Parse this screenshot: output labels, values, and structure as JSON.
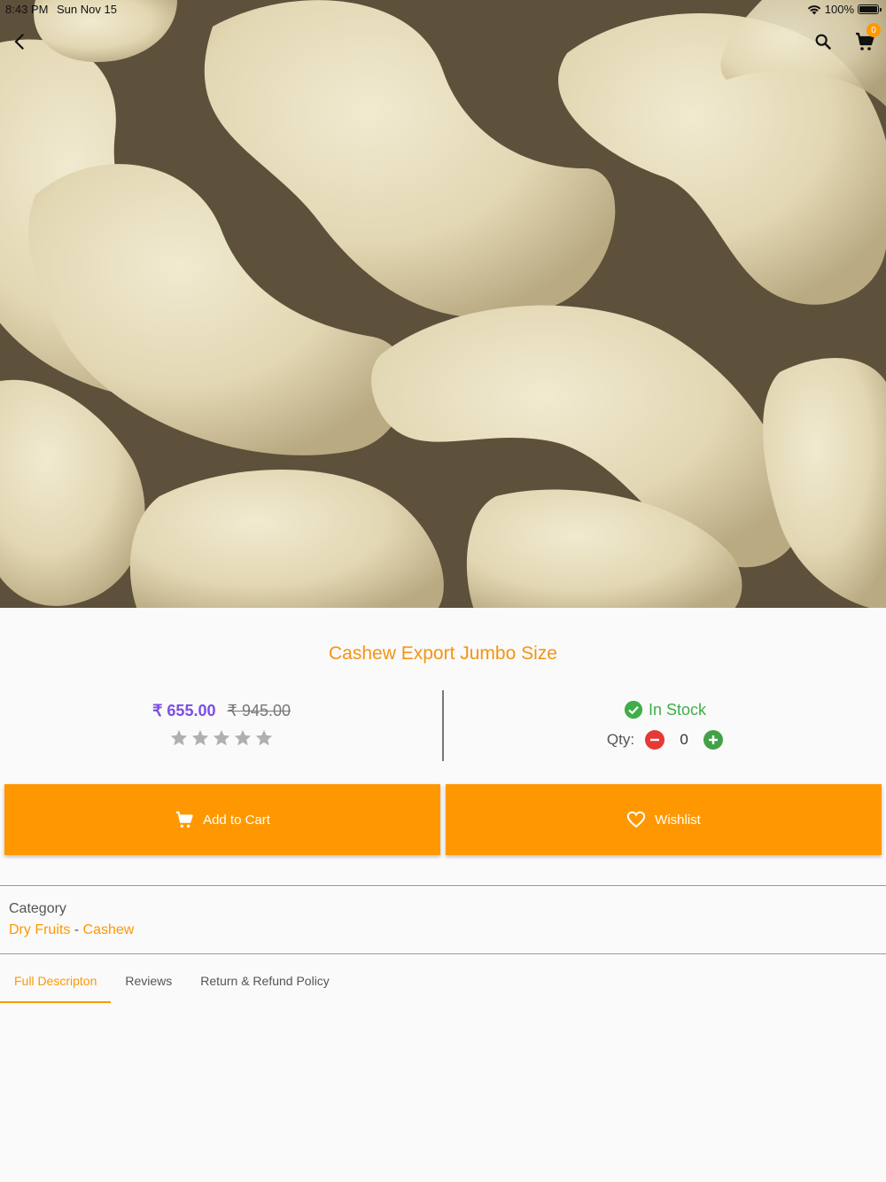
{
  "status_bar": {
    "time": "8:43 PM",
    "date": "Sun Nov 15",
    "battery": "100%"
  },
  "nav": {
    "back_icon": "chevron-left-icon",
    "search_icon": "search-icon",
    "cart_icon": "cart-icon",
    "cart_count": "0"
  },
  "product": {
    "title": "Cashew Export Jumbo Size",
    "price": "₹ 655.00",
    "original_price": "₹ 945.00",
    "rating": 0,
    "rating_max": 5,
    "stock_status": "In Stock",
    "qty_label": "Qty:",
    "qty_value": "0"
  },
  "actions": {
    "add_to_cart": "Add to Cart",
    "wishlist": "Wishlist"
  },
  "category": {
    "label": "Category",
    "parent": "Dry Fruits",
    "separator": " - ",
    "child": "Cashew"
  },
  "tabs": [
    {
      "label": "Full Descripton",
      "active": true
    },
    {
      "label": "Reviews",
      "active": false
    },
    {
      "label": "Return & Refund Policy",
      "active": false
    }
  ],
  "colors": {
    "accent": "#ff9800",
    "title": "#f39412",
    "price": "#7b4ee6",
    "in_stock": "#3fae49",
    "minus": "#e53935",
    "plus": "#43a047"
  }
}
